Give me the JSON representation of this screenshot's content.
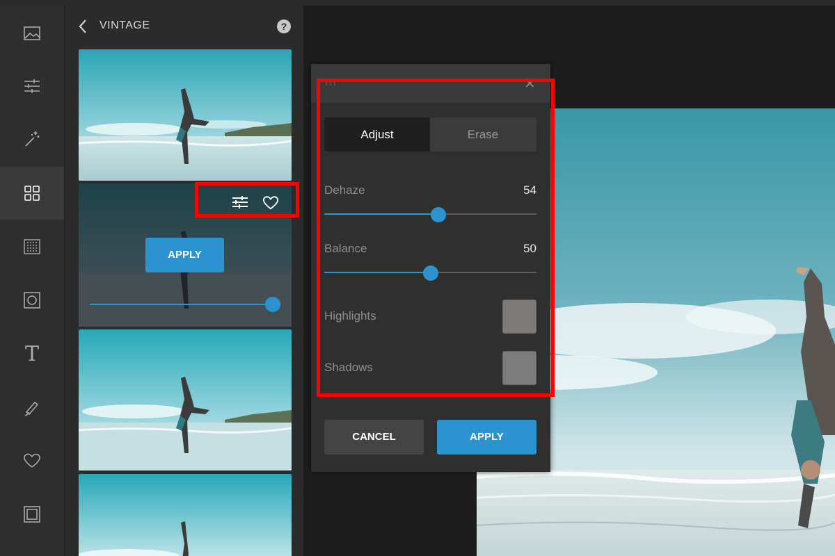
{
  "panel": {
    "title": "VINTAGE",
    "help": "?"
  },
  "rail": {
    "items": [
      {
        "icon": "image-icon"
      },
      {
        "icon": "sliders-icon"
      },
      {
        "icon": "magic-wand-icon"
      },
      {
        "icon": "grid-icon",
        "active": true
      },
      {
        "icon": "texture-icon"
      },
      {
        "icon": "frame-circle-icon"
      },
      {
        "icon": "text-icon",
        "glyph": "T"
      },
      {
        "icon": "brush-icon"
      },
      {
        "icon": "heart-icon"
      },
      {
        "icon": "border-icon"
      }
    ]
  },
  "thumb_overlay": {
    "apply_label": "APPLY",
    "intensity": 1.0
  },
  "popup": {
    "tabs": [
      {
        "label": "Adjust",
        "active": true
      },
      {
        "label": "Erase"
      }
    ],
    "dehaze": {
      "label": "Dehaze",
      "value": "54"
    },
    "balance": {
      "label": "Balance",
      "value": "50"
    },
    "highlights": {
      "label": "Highlights",
      "color": "#7d7a78"
    },
    "shadows": {
      "label": "Shadows",
      "color": "#7c7c7c"
    },
    "cancel_label": "CANCEL",
    "apply_label": "APPLY"
  },
  "colors": {
    "accent": "#2a93d0",
    "highlight_box": "#ff0000"
  }
}
